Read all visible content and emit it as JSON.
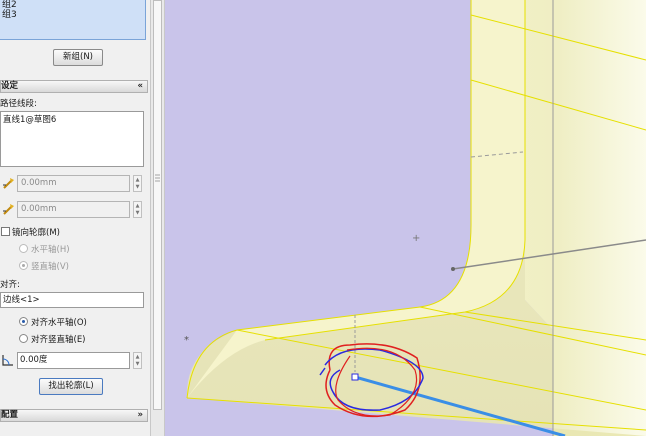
{
  "groups": {
    "items": [
      "组2",
      "组3"
    ],
    "new_group_button": "新组(N)"
  },
  "settings": {
    "header": "设定",
    "collapse_glyph": "«",
    "path_segment_label": "路径线段:",
    "path_segment_value": "直线1@草图6",
    "offset1_value": "0.00mm",
    "offset2_value": "0.00mm",
    "mirror_profile_label": "镜向轮廓(M)",
    "horizontal_axis_label": "水平轴(H)",
    "vertical_axis_label": "竖直轴(V)",
    "align_label": "对齐:",
    "align_value": "边线<1>",
    "align_horizontal_label": "对齐水平轴(O)",
    "align_vertical_label": "对齐竖直轴(E)",
    "angle_value": "0.00度",
    "find_profile_button": "找出轮廓(L)"
  },
  "configuration": {
    "header": "配置",
    "expand_glyph": "»"
  },
  "colors": {
    "viewport_bg": "#c9c4ea",
    "part_face": "#f2f0b8",
    "edge_yellow": "#e8e000",
    "selected_edge_blue": "#3a8ee6",
    "sketch_red": "#e02020",
    "sketch_blue": "#2a2ae0"
  }
}
